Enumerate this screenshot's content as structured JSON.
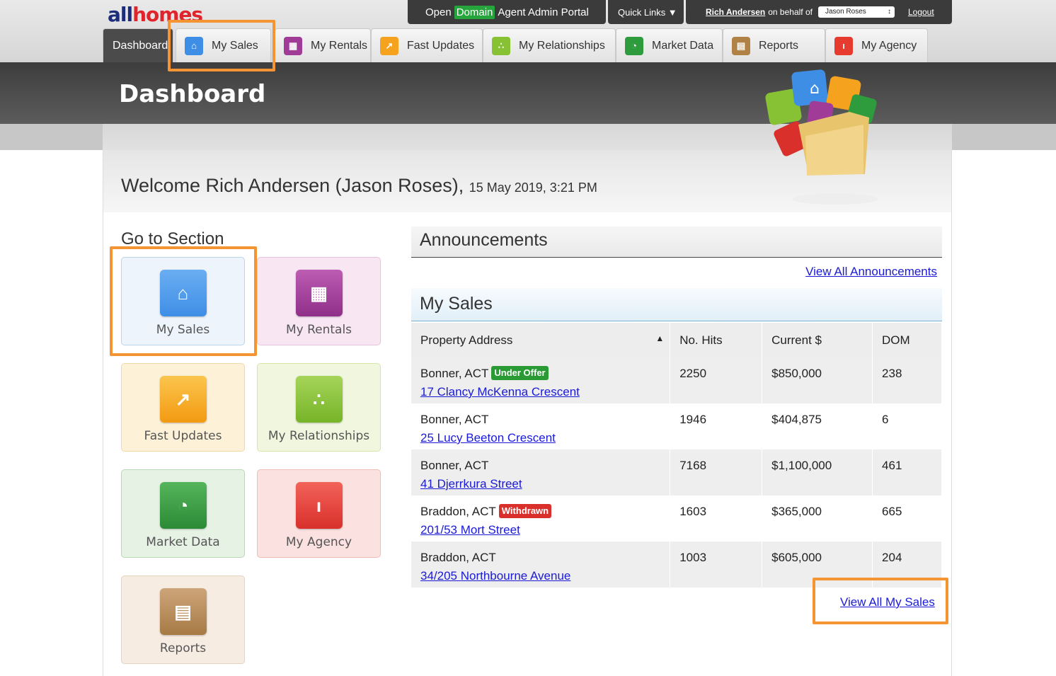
{
  "brand": {
    "logo_all": "all",
    "logo_homes": "homes"
  },
  "topbar": {
    "portal_prefix": "Open",
    "portal_domain": "Domain",
    "portal_suffix": "Agent Admin Portal",
    "quick_links": "Quick Links ▼",
    "user_name": "Rich Andersen",
    "on_behalf_of": "on behalf of",
    "agent_select_value": "Jason Roses",
    "logout": "Logout"
  },
  "tabs": [
    {
      "label": "Dashboard",
      "active": true
    },
    {
      "label": "My Sales",
      "icon": "house-icon",
      "color": "#3f8ee6"
    },
    {
      "label": "My Rentals",
      "icon": "building-icon",
      "color": "#a03c98"
    },
    {
      "label": "Fast Updates",
      "icon": "arrow-icon",
      "color": "#f5a21f"
    },
    {
      "label": "My Relationships",
      "icon": "people-icon",
      "color": "#86c234"
    },
    {
      "label": "Market Data",
      "icon": "pie-chart-icon",
      "color": "#2e9b3d"
    },
    {
      "label": "Reports",
      "icon": "document-icon",
      "color": "#b08245"
    },
    {
      "label": "My Agency",
      "icon": "person-icon",
      "color": "#e63b2e"
    }
  ],
  "page": {
    "title": "Dashboard",
    "welcome": "Welcome Rich Andersen (Jason Roses),",
    "welcome_date": "15 May 2019, 3:21 PM"
  },
  "go_to_section": {
    "title": "Go to Section",
    "tiles": [
      {
        "label": "My Sales",
        "icon": "house-icon",
        "color": "#3f8ee6"
      },
      {
        "label": "My Rentals",
        "icon": "building-icon",
        "color": "#a03c98"
      },
      {
        "label": "Fast Updates",
        "icon": "arrow-icon",
        "color": "#f5a21f"
      },
      {
        "label": "My Relationships",
        "icon": "people-icon",
        "color": "#86c234"
      },
      {
        "label": "Market Data",
        "icon": "pie-chart-icon",
        "color": "#2e9b3d"
      },
      {
        "label": "My Agency",
        "icon": "person-icon",
        "color": "#e63b2e"
      },
      {
        "label": "Reports",
        "icon": "document-icon",
        "color": "#b08245"
      }
    ]
  },
  "announcements": {
    "title": "Announcements",
    "view_all": "View All Announcements"
  },
  "my_sales": {
    "title": "My Sales",
    "columns": [
      "Property Address",
      "No. Hits",
      "Current $",
      "DOM"
    ],
    "sort_indicator": "▲",
    "rows": [
      {
        "suburb": "Bonner, ACT",
        "badge": "Under Offer",
        "badge_color": "#2a9a35",
        "address": "17 Clancy McKenna Crescent",
        "hits": "2250",
        "current": "$850,000",
        "dom": "238"
      },
      {
        "suburb": "Bonner, ACT",
        "badge": "",
        "badge_color": "",
        "address": "25 Lucy Beeton Crescent",
        "hits": "1946",
        "current": "$404,875",
        "dom": "6"
      },
      {
        "suburb": "Bonner, ACT",
        "badge": "",
        "badge_color": "",
        "address": "41 Djerrkura Street",
        "hits": "7168",
        "current": "$1,100,000",
        "dom": "461"
      },
      {
        "suburb": "Braddon, ACT",
        "badge": "Withdrawn",
        "badge_color": "#d9302b",
        "address": "201/53 Mort Street",
        "hits": "1603",
        "current": "$365,000",
        "dom": "665"
      },
      {
        "suburb": "Braddon, ACT",
        "badge": "",
        "badge_color": "",
        "address": "34/205 Northbourne Avenue",
        "hits": "1003",
        "current": "$605,000",
        "dom": "204"
      }
    ],
    "view_all": "View All My Sales"
  },
  "highlight_color": "#f59433"
}
